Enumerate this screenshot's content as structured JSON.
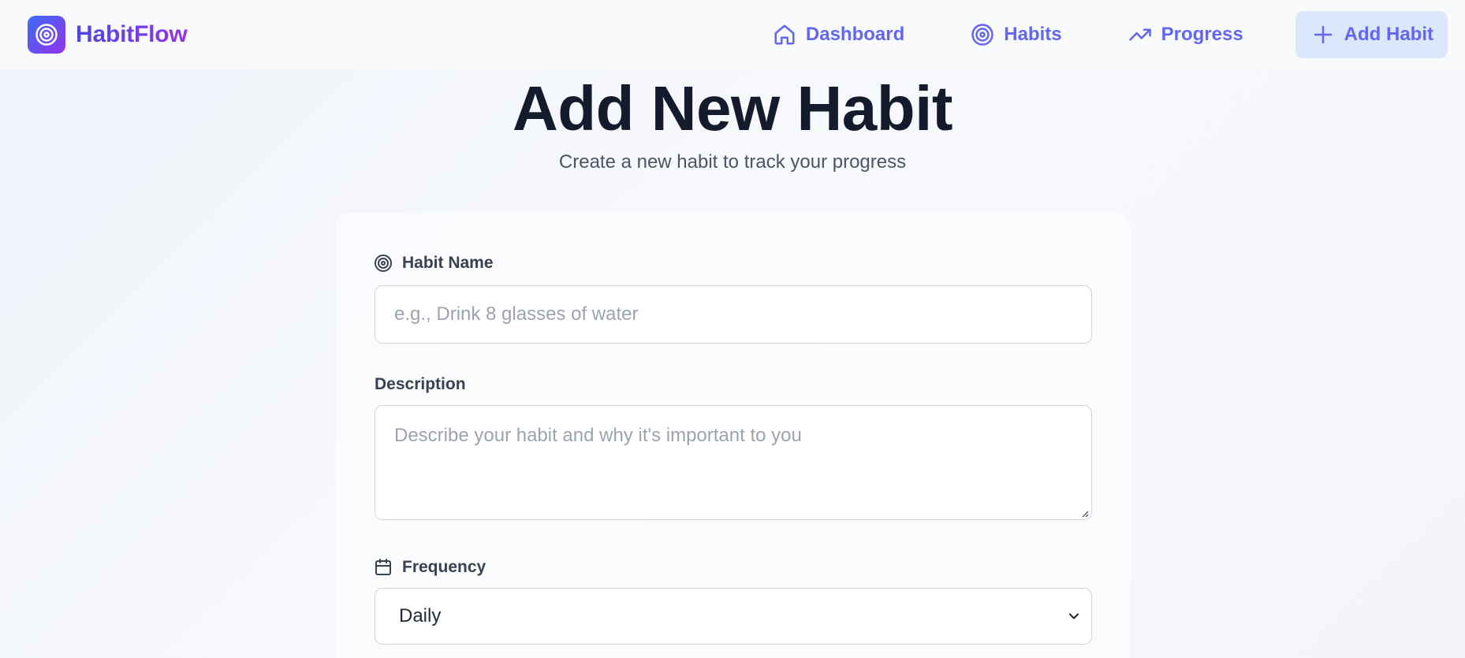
{
  "app": {
    "name": "HabitFlow"
  },
  "nav": {
    "items": [
      {
        "label": "Dashboard",
        "icon": "home-icon"
      },
      {
        "label": "Habits",
        "icon": "target-icon"
      },
      {
        "label": "Progress",
        "icon": "trending-up-icon"
      },
      {
        "label": "Add Habit",
        "icon": "plus-icon",
        "active": true
      }
    ]
  },
  "page": {
    "title": "Add New Habit",
    "subtitle": "Create a new habit to track your progress"
  },
  "form": {
    "name": {
      "label": "Habit Name",
      "placeholder": "e.g., Drink 8 glasses of water",
      "value": "",
      "icon": "target-icon"
    },
    "description": {
      "label": "Description",
      "placeholder": "Describe your habit and why it's important to you",
      "value": ""
    },
    "frequency": {
      "label": "Frequency",
      "value": "Daily",
      "icon": "calendar-icon"
    }
  },
  "colors": {
    "brand_start": "#3b6cf6",
    "brand_end": "#9333ea",
    "nav_text": "#6366f1",
    "active_nav_bg": "#dbe7fb",
    "title": "#131b2d"
  }
}
